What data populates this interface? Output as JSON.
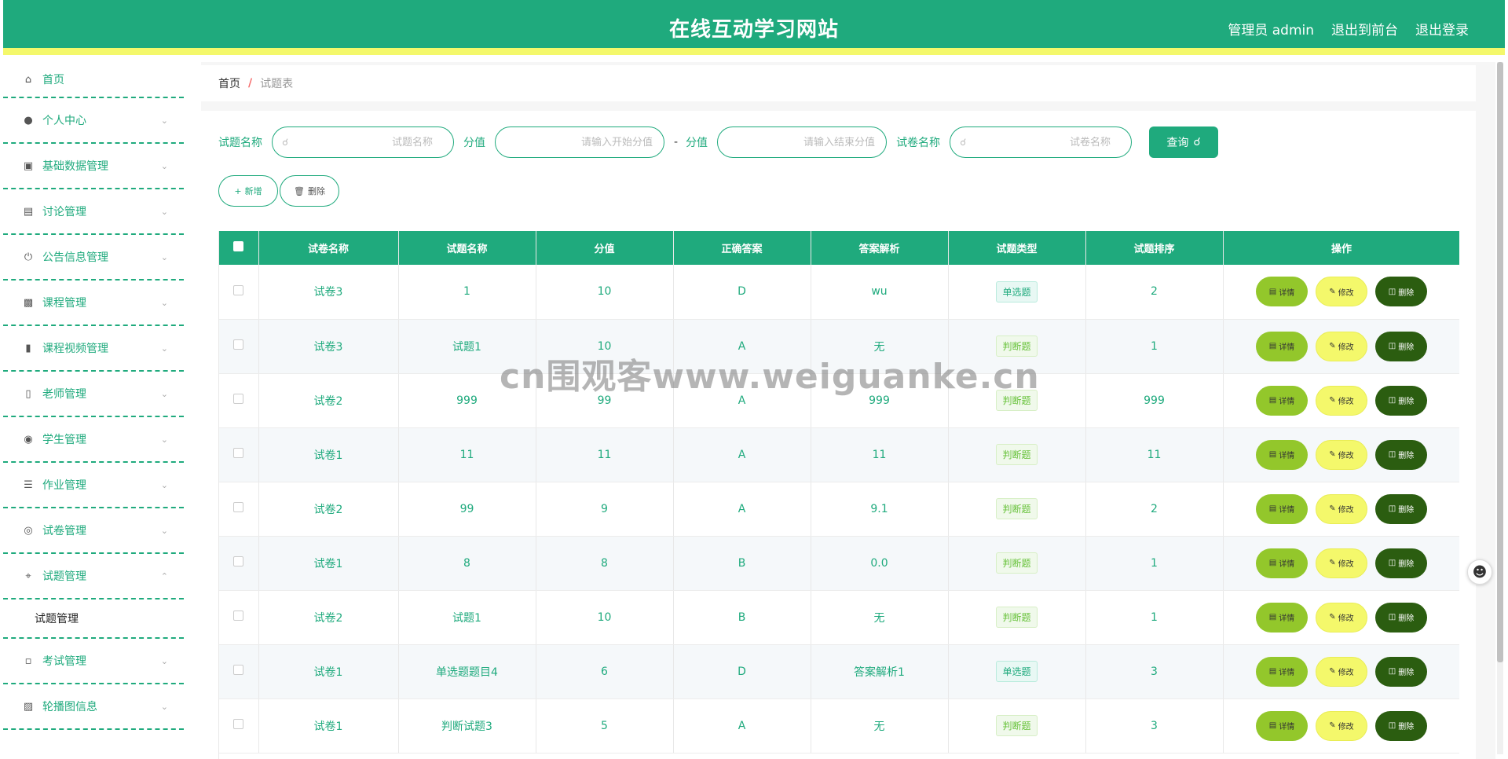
{
  "header": {
    "title": "在线互动学习网站",
    "user_label": "管理员 admin",
    "front_link": "退出到前台",
    "logout_link": "退出登录"
  },
  "sidebar": {
    "items": [
      {
        "label": "首页",
        "icon": "home-icon"
      },
      {
        "label": "个人中心",
        "icon": "user-icon"
      },
      {
        "label": "基础数据管理",
        "icon": "clipboard-icon"
      },
      {
        "label": "讨论管理",
        "icon": "chart-icon"
      },
      {
        "label": "公告信息管理",
        "icon": "power-icon"
      },
      {
        "label": "课程管理",
        "icon": "ticket-icon"
      },
      {
        "label": "课程视频管理",
        "icon": "video-icon"
      },
      {
        "label": "老师管理",
        "icon": "phone-icon"
      },
      {
        "label": "学生管理",
        "icon": "mic-icon"
      },
      {
        "label": "作业管理",
        "icon": "list-icon"
      },
      {
        "label": "试卷管理",
        "icon": "lifebuoy-icon"
      },
      {
        "label": "试题管理",
        "icon": "crop-icon"
      },
      {
        "label": "考试管理",
        "icon": "chat-icon"
      },
      {
        "label": "轮播图信息",
        "icon": "books-icon"
      }
    ],
    "sub_item": "试题管理"
  },
  "breadcrumb": {
    "home": "首页",
    "separator": "/",
    "current": "试题表"
  },
  "search": {
    "label_question": "试题名称",
    "placeholder_question": "试题名称",
    "label_score": "分值",
    "placeholder_score_start": "请输入开始分值",
    "dash": "-",
    "label_score2": "分值",
    "placeholder_score_end": "请输入结束分值",
    "label_paper": "试卷名称",
    "placeholder_paper": "试卷名称",
    "query_button": "查询"
  },
  "actions": {
    "add": "新增",
    "delete": "删除"
  },
  "table": {
    "columns": [
      "试卷名称",
      "试题名称",
      "分值",
      "正确答案",
      "答案解析",
      "试题类型",
      "试题排序",
      "操作"
    ],
    "rows": [
      {
        "paper": "试卷3",
        "question": "1",
        "score": "10",
        "answer": "D",
        "analysis": "wu",
        "type": "单选题",
        "type_class": "single",
        "order": "2"
      },
      {
        "paper": "试卷3",
        "question": "试题1",
        "score": "10",
        "answer": "A",
        "analysis": "无",
        "type": "判断题",
        "type_class": "judge",
        "order": "1"
      },
      {
        "paper": "试卷2",
        "question": "999",
        "score": "99",
        "answer": "A",
        "analysis": "999",
        "type": "判断题",
        "type_class": "judge",
        "order": "999"
      },
      {
        "paper": "试卷1",
        "question": "11",
        "score": "11",
        "answer": "A",
        "analysis": "11",
        "type": "判断题",
        "type_class": "judge",
        "order": "11"
      },
      {
        "paper": "试卷2",
        "question": "99",
        "score": "9",
        "answer": "A",
        "analysis": "9.1",
        "type": "判断题",
        "type_class": "judge",
        "order": "2"
      },
      {
        "paper": "试卷1",
        "question": "8",
        "score": "8",
        "answer": "B",
        "analysis": "0.0",
        "type": "判断题",
        "type_class": "judge",
        "order": "1"
      },
      {
        "paper": "试卷2",
        "question": "试题1",
        "score": "10",
        "answer": "B",
        "analysis": "无",
        "type": "判断题",
        "type_class": "judge",
        "order": "1"
      },
      {
        "paper": "试卷1",
        "question": "单选题题目4",
        "score": "6",
        "answer": "D",
        "analysis": "答案解析1",
        "type": "单选题",
        "type_class": "single",
        "order": "3"
      },
      {
        "paper": "试卷1",
        "question": "判断试题3",
        "score": "5",
        "answer": "A",
        "analysis": "无",
        "type": "判断题",
        "type_class": "judge",
        "order": "3"
      }
    ],
    "op_labels": {
      "detail": "详情",
      "edit": "修改",
      "delete": "删除"
    }
  },
  "watermark": "cn围观客www.weiguanke.cn",
  "colors": {
    "primary": "#1faa7d",
    "accent_yellow": "#f4f86b",
    "detail_btn": "#93c72b",
    "delete_btn": "#2b5d10"
  }
}
